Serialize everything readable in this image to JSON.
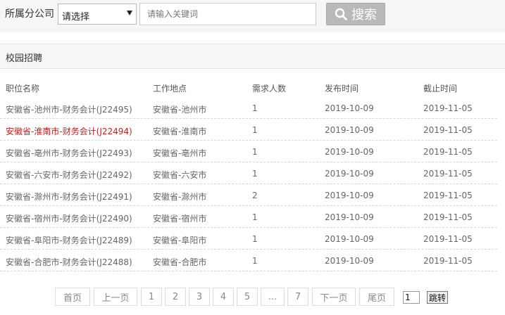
{
  "search": {
    "label": "所属分公司",
    "select_value": "请选择",
    "keyword_placeholder": "请输入关键词",
    "button_label": "搜索"
  },
  "section": {
    "title": "校园招聘"
  },
  "table": {
    "columns": [
      "职位名称",
      "工作地点",
      "需求人数",
      "发布时间",
      "截止时间"
    ],
    "rows": [
      {
        "title": "安徽省-池州市-财务会计(J22495)",
        "location": "安徽省-池州市",
        "count": "1",
        "published": "2019-10-09",
        "deadline": "2019-11-05"
      },
      {
        "title": "安徽省-淮南市-财务会计(J22494)",
        "location": "安徽省-淮南市",
        "count": "1",
        "published": "2019-10-09",
        "deadline": "2019-11-05"
      },
      {
        "title": "安徽省-亳州市-财务会计(J22493)",
        "location": "安徽省-亳州市",
        "count": "1",
        "published": "2019-10-09",
        "deadline": "2019-11-05"
      },
      {
        "title": "安徽省-六安市-财务会计(J22492)",
        "location": "安徽省-六安市",
        "count": "1",
        "published": "2019-10-09",
        "deadline": "2019-11-05"
      },
      {
        "title": "安徽省-滁州市-财务会计(J22491)",
        "location": "安徽省-滁州市",
        "count": "2",
        "published": "2019-10-09",
        "deadline": "2019-11-05"
      },
      {
        "title": "安徽省-宿州市-财务会计(J22490)",
        "location": "安徽省-宿州市",
        "count": "1",
        "published": "2019-10-09",
        "deadline": "2019-11-05"
      },
      {
        "title": "安徽省-阜阳市-财务会计(J22489)",
        "location": "安徽省-阜阳市",
        "count": "1",
        "published": "2019-10-09",
        "deadline": "2019-11-05"
      },
      {
        "title": "安徽省-合肥市-财务会计(J22488)",
        "location": "安徽省-合肥市",
        "count": "1",
        "published": "2019-10-09",
        "deadline": "2019-11-05"
      }
    ]
  },
  "pagination": {
    "first": "首页",
    "prev": "上一页",
    "pages": [
      "1",
      "2",
      "3",
      "4",
      "5",
      "...",
      "7"
    ],
    "next": "下一页",
    "last": "尾页",
    "current_input": "1",
    "jump": "跳转"
  },
  "colors": {
    "highlight_row": "#cc1b1b",
    "search_button": "#b9b9b9"
  },
  "icons": {
    "search": "search-icon"
  }
}
